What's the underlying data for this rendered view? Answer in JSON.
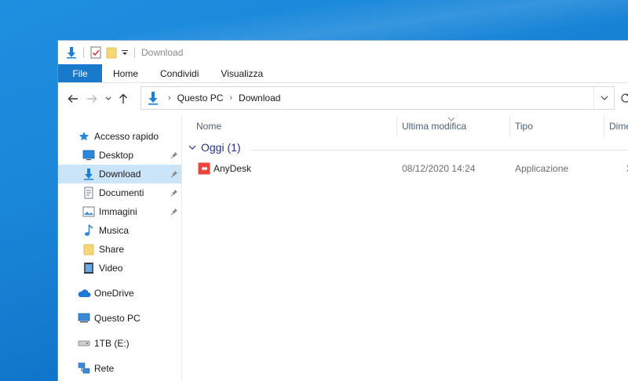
{
  "window": {
    "title": "Download"
  },
  "ribbon": {
    "tabs": [
      {
        "label": "File"
      },
      {
        "label": "Home"
      },
      {
        "label": "Condividi"
      },
      {
        "label": "Visualizza"
      }
    ]
  },
  "address": {
    "crumbs": [
      "Questo PC",
      "Download"
    ]
  },
  "sidebar": {
    "quick_access": "Accesso rapido",
    "items": [
      {
        "label": "Desktop",
        "icon": "desktop-icon",
        "pinned": true
      },
      {
        "label": "Download",
        "icon": "download-icon",
        "pinned": true,
        "selected": true
      },
      {
        "label": "Documenti",
        "icon": "documents-icon",
        "pinned": true
      },
      {
        "label": "Immagini",
        "icon": "pictures-icon",
        "pinned": true
      },
      {
        "label": "Musica",
        "icon": "music-icon",
        "pinned": false
      },
      {
        "label": "Share",
        "icon": "folder-icon",
        "pinned": false
      },
      {
        "label": "Video",
        "icon": "video-icon",
        "pinned": false
      }
    ],
    "onedrive": "OneDrive",
    "this_pc": "Questo PC",
    "drive": "1TB (E:)",
    "network": "Rete"
  },
  "columns": {
    "name": "Nome",
    "modified": "Ultima modifica",
    "type": "Tipo",
    "size": "Dime"
  },
  "group": {
    "label": "Oggi (1)"
  },
  "files": [
    {
      "name": "AnyDesk",
      "modified": "08/12/2020 14:24",
      "type": "Applicazione",
      "size": "3"
    }
  ],
  "colors": {
    "accent": "#1979ca",
    "selected": "#cce4f7",
    "group_text": "#1e3287",
    "anydesk": "#ef443b"
  }
}
